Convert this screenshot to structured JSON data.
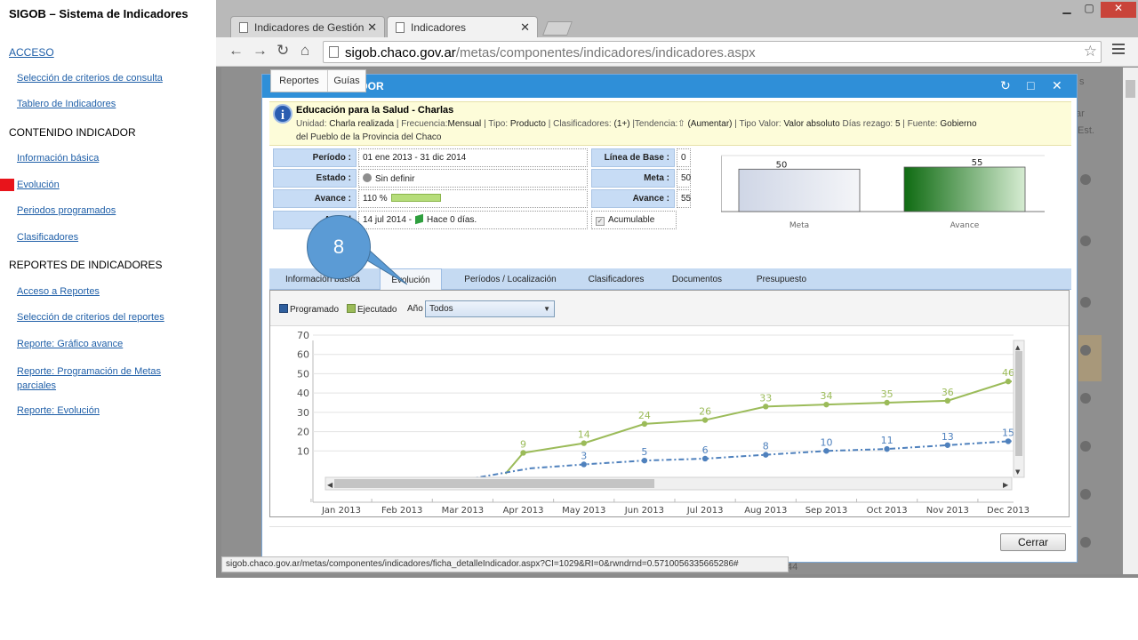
{
  "sidebar": {
    "title": "SIGOB – Sistema de Indicadores",
    "acceso": "ACCESO",
    "seleccion_criterios": "Selección de criterios de consulta",
    "tablero": "Tablero de Indicadores",
    "contenido_head": "CONTENIDO INDICADOR",
    "informacion_basica": "Información básica",
    "evolucion": "Evolución",
    "periodos_programados": "Periodos programados",
    "clasificadores": "Clasificadores",
    "reportes_head": "REPORTES DE INDICADORES",
    "acceso_reportes": "Acceso a Reportes",
    "seleccion_reportes": "Selección de criterios del reportes",
    "reporte_grafico": "Reporte: Gráfico avance",
    "reporte_programacion": "Reporte: Programación de Metas parciales",
    "reporte_evolucion": "Reporte: Evolución"
  },
  "browser": {
    "tab1": "Indicadores de Gestión",
    "tab2": "Indicadores",
    "tab_close": "✕",
    "url_host": "sigob.chaco.gov.ar",
    "url_path": "/metas/componentes/indicadores/indicadores.aspx",
    "status_url": "sigob.chaco.gov.ar/metas/componentes/indicadores/ficha_detalleIndicador.aspx?CI=1029&RI=0&rwndrnd=0.5710056335665286#"
  },
  "background": {
    "col_est": "Est.",
    "col_ar": "ar",
    "col_s": "s",
    "col_44": "44"
  },
  "modal": {
    "title": "DOR",
    "menu_reportes": "Reportes",
    "menu_guias": "Guías",
    "indicator_title": "Educación para la Salud - Charlas",
    "meta_line1": {
      "unidad_lbl": "Unidad:",
      "unidad": "Charla realizada",
      "frecuencia_lbl": "| Frecuencia:",
      "frecuencia": "Mensual",
      "tipo_lbl": "| Tipo:",
      "tipo": "Producto",
      "clasif_lbl": "| Clasificadores:",
      "clasif": "(1+)",
      "tendencia_lbl": "|Tendencia:",
      "tendencia": "(Aumentar)",
      "tipo_valor_lbl": "| Tipo Valor:",
      "tipo_valor": "Valor absoluto",
      "rezago_lbl": "Días rezago:",
      "rezago": "5",
      "fuente_lbl": "| Fuente:",
      "fuente": "Gobierno"
    },
    "meta_line2": "del Pueblo de la Provincia del Chaco",
    "fields": {
      "periodo_lbl": "Período :",
      "periodo": "01 ene 2013 - 31 dic 2014",
      "estado_lbl": "Estado :",
      "estado": "Sin definir",
      "avance_lbl": "Avance :",
      "avance": "110 %",
      "actual_lbl": "Actual",
      "actual_date": "14 jul 2014 -",
      "actual_hace": "Hace 0 días.",
      "linea_base_lbl": "Línea de Base :",
      "linea_base": "0",
      "meta_lbl": "Meta :",
      "meta": "50",
      "avance2_lbl": "Avance :",
      "avance2": "55",
      "acumulable": "Acumulable"
    },
    "tabs": [
      "Información básica",
      "Evolución",
      "Períodos / Localización",
      "Clasificadores",
      "Documentos",
      "Presupuesto"
    ],
    "legend_programado": "Programado",
    "legend_ejecutado": "Ejecutado",
    "anio_label": "Año",
    "anio_value": "Todos",
    "close_button": "Cerrar"
  },
  "callout": "8",
  "chart_data": [
    {
      "type": "bar",
      "categories": [
        "Meta",
        "Avance"
      ],
      "values": [
        50,
        55
      ],
      "colors": [
        "#dfe3ee",
        "#1f7a1f"
      ]
    },
    {
      "type": "line",
      "categories": [
        "Jan 2013",
        "Feb 2013",
        "Mar 2013",
        "Apr 2013",
        "May 2013",
        "Jun 2013",
        "Jul 2013",
        "Aug 2013",
        "Sep 2013",
        "Oct 2013",
        "Nov 2013",
        "Dec 2013"
      ],
      "ylim": [
        0,
        70
      ],
      "yticks": [
        10,
        20,
        30,
        40,
        50,
        60,
        70
      ],
      "series": [
        {
          "name": "Ejecutado",
          "color": "#9bbb59",
          "values": [
            null,
            null,
            null,
            9,
            14,
            24,
            26,
            33,
            34,
            35,
            36,
            46
          ]
        },
        {
          "name": "Programado",
          "color": "#4f81bd",
          "values": [
            null,
            null,
            null,
            null,
            3,
            5,
            6,
            8,
            10,
            11,
            13,
            15
          ]
        }
      ]
    }
  ]
}
